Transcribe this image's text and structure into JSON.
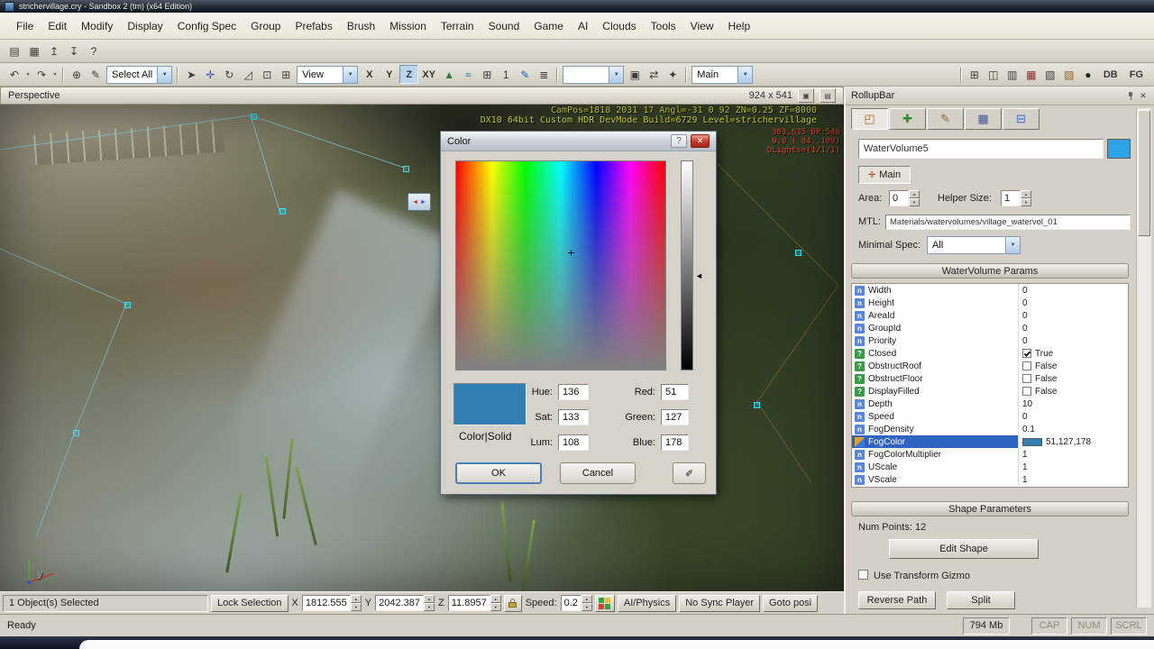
{
  "window": {
    "title": "strichervillage.cry - Sandbox 2 (tm) (x64 Edition)"
  },
  "icons": {
    "chevron_down": "▼",
    "spin_up": "▲",
    "spin_down": "▼",
    "close": "✕",
    "help": "?",
    "dropper": "✐",
    "left_arrow": "◄",
    "maximize": "▣",
    "layout": "▤",
    "main_axis": "✛",
    "crosshair": "+",
    "helper_left": "◄",
    "helper_right": "►"
  },
  "menu": {
    "items": [
      "File",
      "Edit",
      "Modify",
      "Display",
      "Config Spec",
      "Group",
      "Prefabs",
      "Brush",
      "Mission",
      "Terrain",
      "Sound",
      "Game",
      "AI",
      "Clouds",
      "Tools",
      "View",
      "Help"
    ]
  },
  "toolbar1": {
    "icons": [
      {
        "g": "▤",
        "n": "open-icon"
      },
      {
        "g": "▦",
        "n": "save-icon"
      },
      {
        "g": "↥",
        "n": "export-icon"
      },
      {
        "g": "↧",
        "n": "import-icon"
      },
      {
        "g": "?",
        "n": "help-icon"
      }
    ]
  },
  "toolbar2": {
    "left_icons": [
      {
        "g": "↶",
        "n": "undo-icon"
      },
      {
        "g": "▾",
        "n": "undo-history-icon",
        "sm": true
      },
      {
        "g": "↷",
        "n": "redo-icon"
      },
      {
        "g": "▾",
        "n": "redo-history-icon",
        "sm": true
      },
      {
        "sep": true,
        "n": "separator"
      },
      {
        "g": "⊕",
        "n": "pick-object-icon"
      },
      {
        "g": "✎",
        "n": "pick-material-icon"
      }
    ],
    "select_all_label": "Select All",
    "tool_icons": [
      {
        "sep": true,
        "n": "separator"
      },
      {
        "g": "➤",
        "n": "select-cursor-icon"
      },
      {
        "g": "✛",
        "n": "move-tool-icon",
        "c": "#2a56c0"
      },
      {
        "g": "↻",
        "n": "rotate-tool-icon"
      },
      {
        "g": "◿",
        "n": "scale-tool-icon"
      },
      {
        "g": "⊡",
        "n": "select-area-icon"
      },
      {
        "g": "⊞",
        "n": "snap-grid-icon"
      }
    ],
    "view_label": "View",
    "axis_buttons": [
      {
        "label": "X"
      },
      {
        "label": "Y"
      },
      {
        "label": "Z",
        "pressed": true
      },
      {
        "label": "XY"
      }
    ],
    "mid_icons": [
      {
        "g": "▲",
        "n": "terrain-tool-icon",
        "c": "#2e7d32"
      },
      {
        "g": "≈",
        "n": "ocean-tool-icon",
        "c": "#1565c0"
      },
      {
        "g": "⊞",
        "n": "snap-size-icon"
      },
      {
        "g": "1",
        "n": "snap-size-label"
      },
      {
        "g": "✎",
        "n": "edit-tool-icon",
        "c": "#1565c0"
      },
      {
        "g": "≣",
        "n": "layer-list-icon"
      },
      {
        "sep": true,
        "n": "separator"
      }
    ],
    "post_icons": [
      {
        "g": "▣",
        "n": "duplicate-icon"
      },
      {
        "g": "⇄",
        "n": "reload-icon"
      },
      {
        "g": "✦",
        "n": "goto-selection-icon"
      },
      {
        "sep": true,
        "n": "separator"
      }
    ],
    "main_label": "Main",
    "right_icons": [
      {
        "sep": true,
        "n": "separator"
      },
      {
        "g": "⊞",
        "n": "layout-grid-icon"
      },
      {
        "g": "◫",
        "n": "split-view-icon"
      },
      {
        "g": "▥",
        "n": "rows-view-icon"
      },
      {
        "g": "▦",
        "n": "table-view-icon",
        "c": "#8a2a2a"
      },
      {
        "g": "▧",
        "n": "snap-angle-icon"
      },
      {
        "g": "▨",
        "n": "measure-icon",
        "c": "#a05a1a"
      },
      {
        "g": "●",
        "n": "render-sphere-icon",
        "c": "#232a32"
      }
    ],
    "db_label": "DB",
    "fg_label": "FG"
  },
  "viewport": {
    "label": "Perspective",
    "size_label": "924 x 541",
    "hud_line1": "CamPos=1818 2031 17 Angl=-31 0 92 ZN=0.25 ZF=8000",
    "hud_line2": "DX10 64bit Custom HDR DevMode Build=6729 Level=strichervillage",
    "stats": [
      "303,635 DP:546",
      "0.0 ( 84..109)",
      "DLights=(1/1/1)"
    ],
    "axis_label": "y"
  },
  "dialog": {
    "title": "Color",
    "swatch_color": "#337fb2",
    "mode_label": "Color|Solid",
    "hue_label": "Hue:",
    "hue": "136",
    "sat_label": "Sat:",
    "sat": "133",
    "lum_label": "Lum:",
    "lum": "108",
    "red_label": "Red:",
    "red": "51",
    "green_label": "Green:",
    "green": "127",
    "blue_label": "Blue:",
    "blue": "178",
    "ok_label": "OK",
    "cancel_label": "Cancel"
  },
  "rollupbar": {
    "title": "RollupBar",
    "tabs": [
      {
        "g": "◰",
        "n": "objects-tab-icon",
        "c": "#b06a2a",
        "active": true
      },
      {
        "g": "✚",
        "n": "terrain-tab-icon",
        "c": "#2e8b2e"
      },
      {
        "g": "✎",
        "n": "modelling-tab-icon",
        "c": "#8a6a3a"
      },
      {
        "g": "▦",
        "n": "display-tab-icon",
        "c": "#3a5aaa"
      },
      {
        "g": "⊟",
        "n": "layers-tab-icon",
        "c": "#3a6ad0"
      }
    ],
    "name_value": "WaterVolume5",
    "name_swatch": "#2fa3e6",
    "main_toggle": "Main",
    "area_label": "Area:",
    "area_value": "0",
    "helper_label": "Helper Size:",
    "helper_value": "1",
    "mtl_label": "MTL:",
    "mtl_value": "Materials/watervolumes/village_watervol_01",
    "spec_label": "Minimal Spec:",
    "spec_value": "All",
    "params_header": "WaterVolume Params",
    "params": [
      {
        "name": "Width",
        "value": "0",
        "kind": "n",
        "icon": "n"
      },
      {
        "name": "Height",
        "value": "0",
        "kind": "n",
        "icon": "n"
      },
      {
        "name": "AreaId",
        "value": "0",
        "kind": "n",
        "icon": "n"
      },
      {
        "name": "GroupId",
        "value": "0",
        "kind": "n",
        "icon": "n"
      },
      {
        "name": "Priority",
        "value": "0",
        "kind": "n",
        "icon": "n"
      },
      {
        "name": "Closed",
        "value": "True",
        "kind": "b",
        "icon": "?",
        "bool": true,
        "checked": true
      },
      {
        "name": "ObstructRoof",
        "value": "False",
        "kind": "b",
        "icon": "?",
        "bool": true
      },
      {
        "name": "ObstructFloor",
        "value": "False",
        "kind": "b",
        "icon": "?",
        "bool": true
      },
      {
        "name": "DisplayFilled",
        "value": "False",
        "kind": "b",
        "icon": "?",
        "bool": true
      },
      {
        "name": "Depth",
        "value": "10",
        "kind": "n",
        "icon": "n"
      },
      {
        "name": "Speed",
        "value": "0",
        "kind": "n",
        "icon": "n"
      },
      {
        "name": "FogDensity",
        "value": "0.1",
        "kind": "n",
        "icon": "n"
      },
      {
        "name": "FogColor",
        "value": "51,127,178",
        "kind": "c",
        "icon": "c",
        "selected": true,
        "swatch": "#337fb2"
      },
      {
        "name": "FogColorMultiplier",
        "value": "1",
        "kind": "n",
        "icon": "n"
      },
      {
        "name": "UScale",
        "value": "1",
        "kind": "n",
        "icon": "n"
      },
      {
        "name": "VScale",
        "value": "1",
        "kind": "n",
        "icon": "n"
      }
    ],
    "shape_header": "Shape Parameters",
    "num_points_label": "Num Points: 12",
    "edit_shape_label": "Edit Shape",
    "transform_label": "Use Transform Gizmo",
    "reverse_label": "Reverse Path",
    "split_label": "Split"
  },
  "statusbar": {
    "selected_text": "1 Object(s) Selected",
    "lock_selection": "Lock Selection",
    "x_label": "X",
    "x_value": "1812.555",
    "y_label": "Y",
    "y_value": "2042.387",
    "z_label": "Z",
    "z_value": "11.8957",
    "speed_label": "Speed:",
    "speed_value": "0.2",
    "ai_physics": "AI/Physics",
    "no_sync": "No Sync Player",
    "goto_pos": "Goto posi",
    "ready": "Ready",
    "memory": "794 Mb",
    "cap": "CAP",
    "num": "NUM",
    "scrl": "SCRL"
  }
}
